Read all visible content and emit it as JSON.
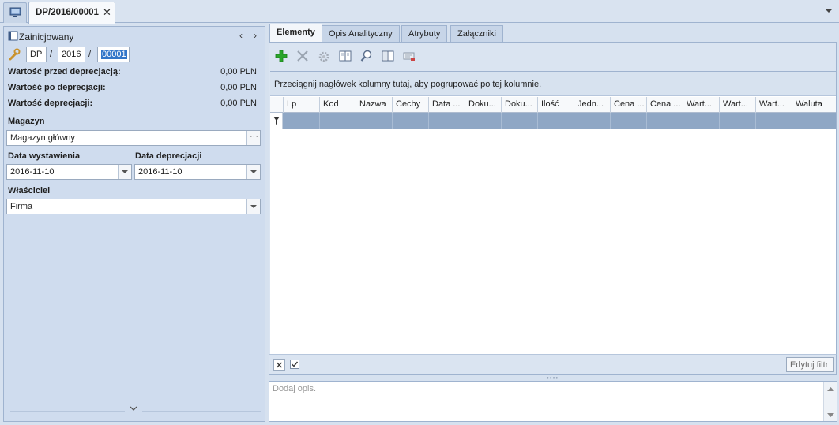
{
  "tabs": {
    "document_tab": "DP/2016/00001"
  },
  "left": {
    "status": "Zainicjowany",
    "number": {
      "series": "DP",
      "year": "2016",
      "number": "00001"
    },
    "values": [
      {
        "label": "Wartość przed deprecjacją:",
        "amount": "0,00 PLN"
      },
      {
        "label": "Wartość po deprecjacji:",
        "amount": "0,00 PLN"
      },
      {
        "label": "Wartość deprecjacji:",
        "amount": "0,00 PLN"
      }
    ],
    "magazyn": {
      "label": "Magazyn",
      "value": "Magazyn główny",
      "button": "···"
    },
    "data_wystawienia": {
      "label": "Data wystawienia",
      "value": "2016-11-10"
    },
    "data_deprecjacji": {
      "label": "Data deprecjacji",
      "value": "2016-11-10"
    },
    "wlasciciel": {
      "label": "Właściciel",
      "value": "Firma"
    }
  },
  "panel_tabs": [
    "Elementy",
    "Opis Analityczny",
    "Atrybuty",
    "Załączniki"
  ],
  "grid": {
    "group_hint": "Przeciągnij nagłówek kolumny tutaj, aby pogrupować po tej kolumnie.",
    "columns": [
      "Lp",
      "Kod",
      "Nazwa",
      "Cechy",
      "Data ...",
      "Doku...",
      "Doku...",
      "Ilość",
      "Jedn...",
      "Cena ...",
      "Cena ...",
      "Wart...",
      "Wart...",
      "Wart...",
      "Waluta"
    ],
    "edit_filter": "Edytuj filtr"
  },
  "description": {
    "placeholder": "Dodaj opis."
  },
  "icons": {
    "home": "monitor-icon",
    "status": "book-icon",
    "number": "wrench-icon",
    "toolbar": [
      "add-icon",
      "delete-icon",
      "gear-icon",
      "book-icon",
      "search-icon",
      "book-open-icon",
      "export-icon"
    ]
  },
  "colors": {
    "accent": "#3276c9",
    "filter_row": "#8fa7c5",
    "add_green": "#2aa52a"
  }
}
